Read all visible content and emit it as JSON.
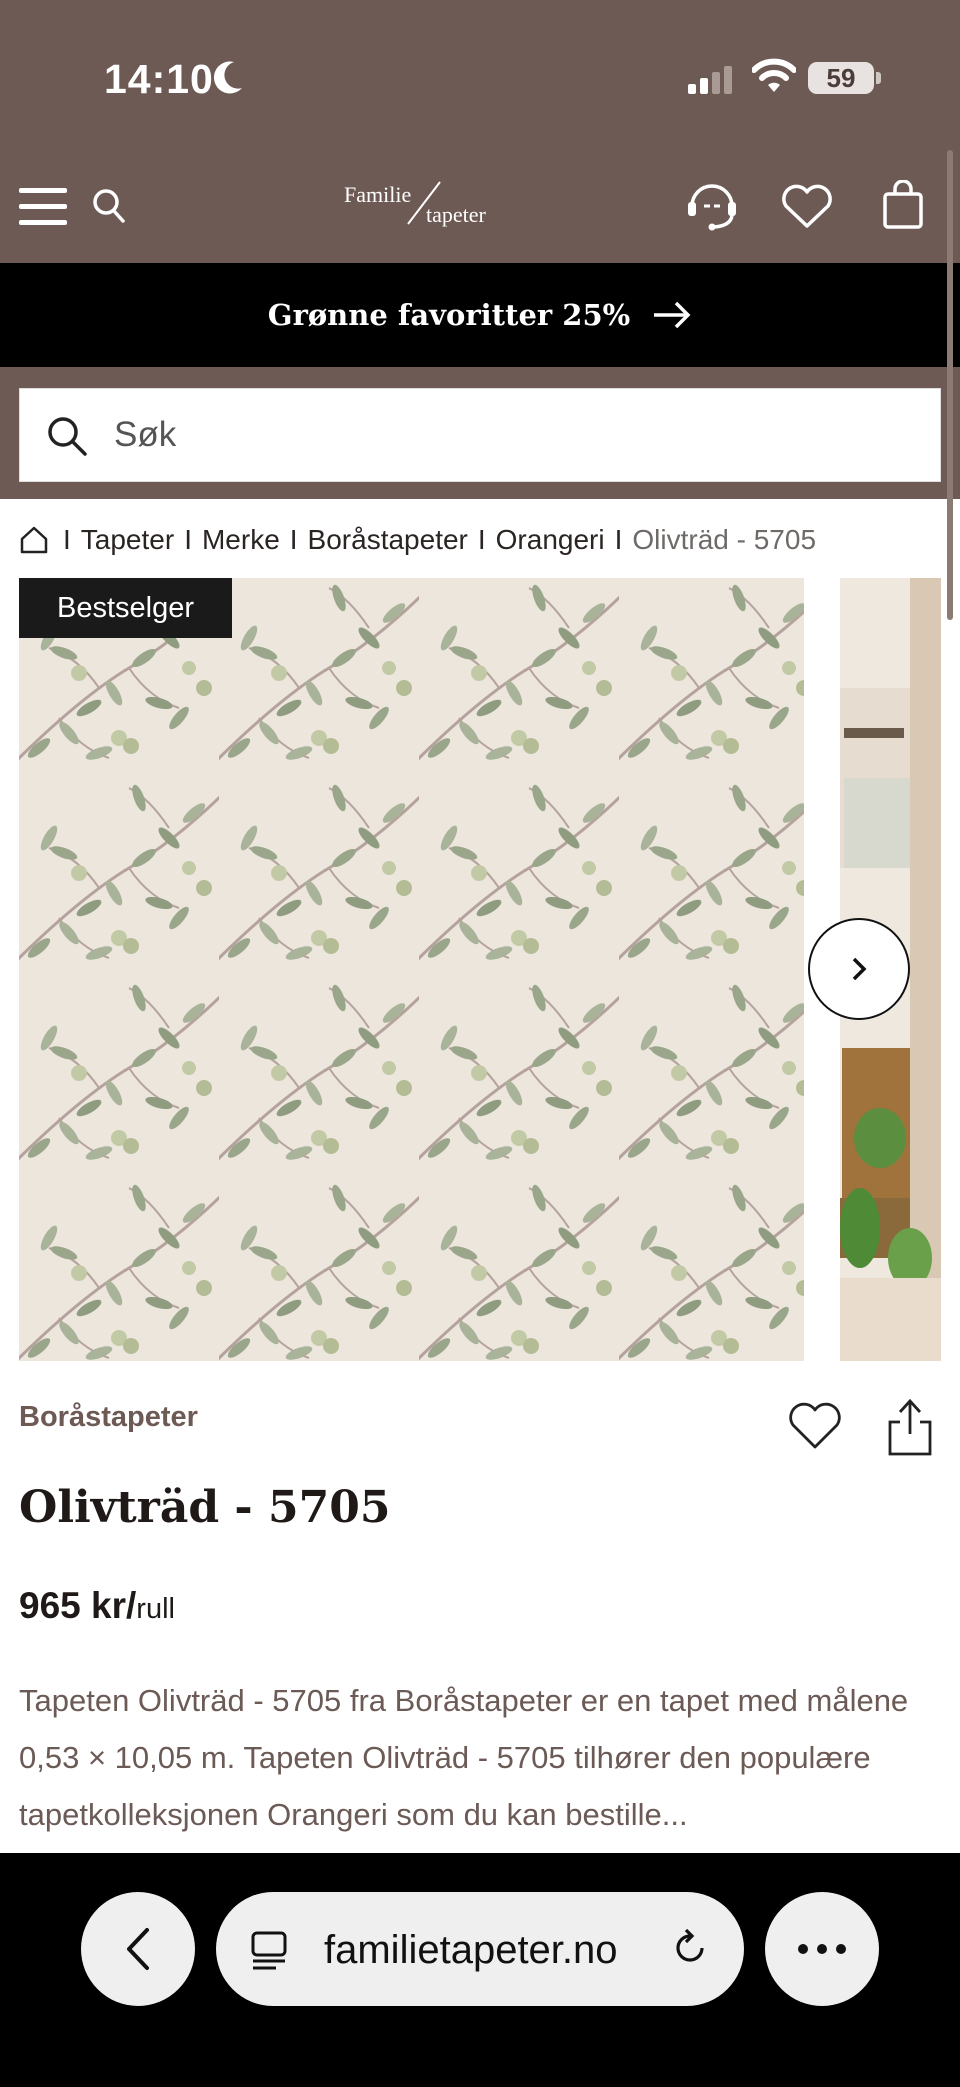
{
  "status_bar": {
    "time": "14:10",
    "battery": "59"
  },
  "header": {
    "logo_line1": "Familie",
    "logo_line2": "tapeter"
  },
  "promo": {
    "text": "Grønne favoritter 25%"
  },
  "search": {
    "placeholder": "Søk"
  },
  "breadcrumb": {
    "items": [
      "Tapeter",
      "Merke",
      "Boråstapeter",
      "Orangeri"
    ],
    "current": "Olivträd - 5705"
  },
  "gallery": {
    "badge": "Bestselger"
  },
  "product": {
    "brand": "Boråstapeter",
    "title": "Olivträd - 5705",
    "price": "965 kr/",
    "price_unit": "rull",
    "description": "Tapeten Olivträd - 5705 fra Boråstapeter er en tapet med målene 0,53 × 10,05 m. Tapeten Olivträd - 5705 tilhører den populære tapetkolleksjonen Orangeri som du kan bestille..."
  },
  "browser": {
    "url": "familietapeter.no"
  },
  "colors": {
    "brand_brown": "#6e5a54",
    "promo_black": "#000000",
    "leaf_green": "#9aa68a",
    "background_cream": "#ece6dd"
  }
}
